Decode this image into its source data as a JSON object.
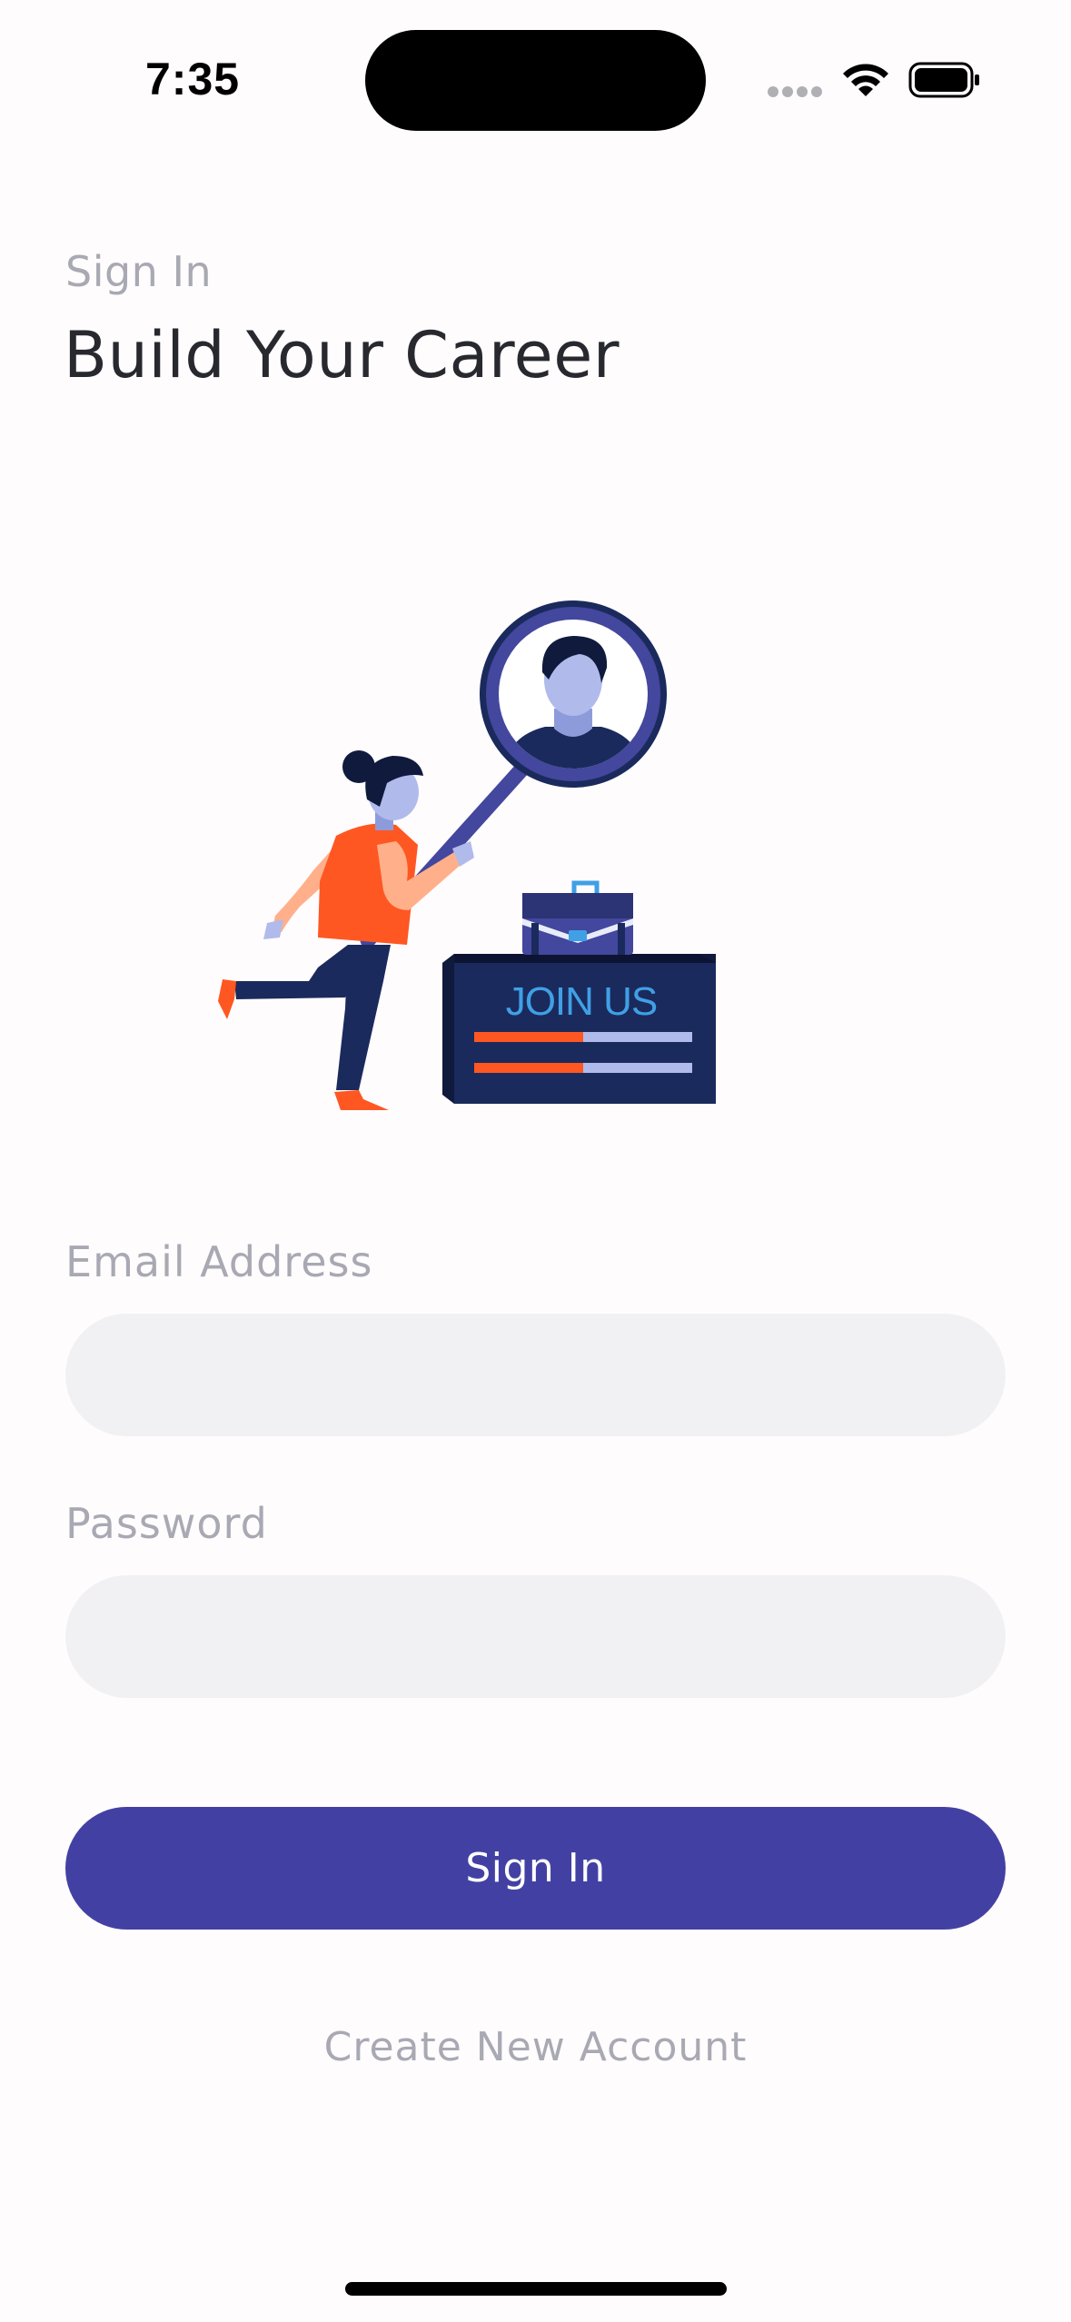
{
  "status_bar": {
    "time": "7:35"
  },
  "header": {
    "subtitle": "Sign In",
    "title": "Build Your Career"
  },
  "illustration": {
    "sign_text": "JOIN US",
    "colors": {
      "navy": "#1b2a5c",
      "indigo": "#43479d",
      "light_blue": "#b0bbeb",
      "orange": "#ff5722",
      "skin": "#ffb08a"
    }
  },
  "form": {
    "email": {
      "label": "Email Address",
      "value": "",
      "placeholder": ""
    },
    "password": {
      "label": "Password",
      "value": "",
      "placeholder": ""
    },
    "submit_label": "Sign In",
    "create_account_label": "Create New Account"
  },
  "theme": {
    "primary": "#4241a3",
    "input_bg": "#f1f1f4",
    "muted_text": "#a8a9b2",
    "title_text": "#27292e"
  }
}
